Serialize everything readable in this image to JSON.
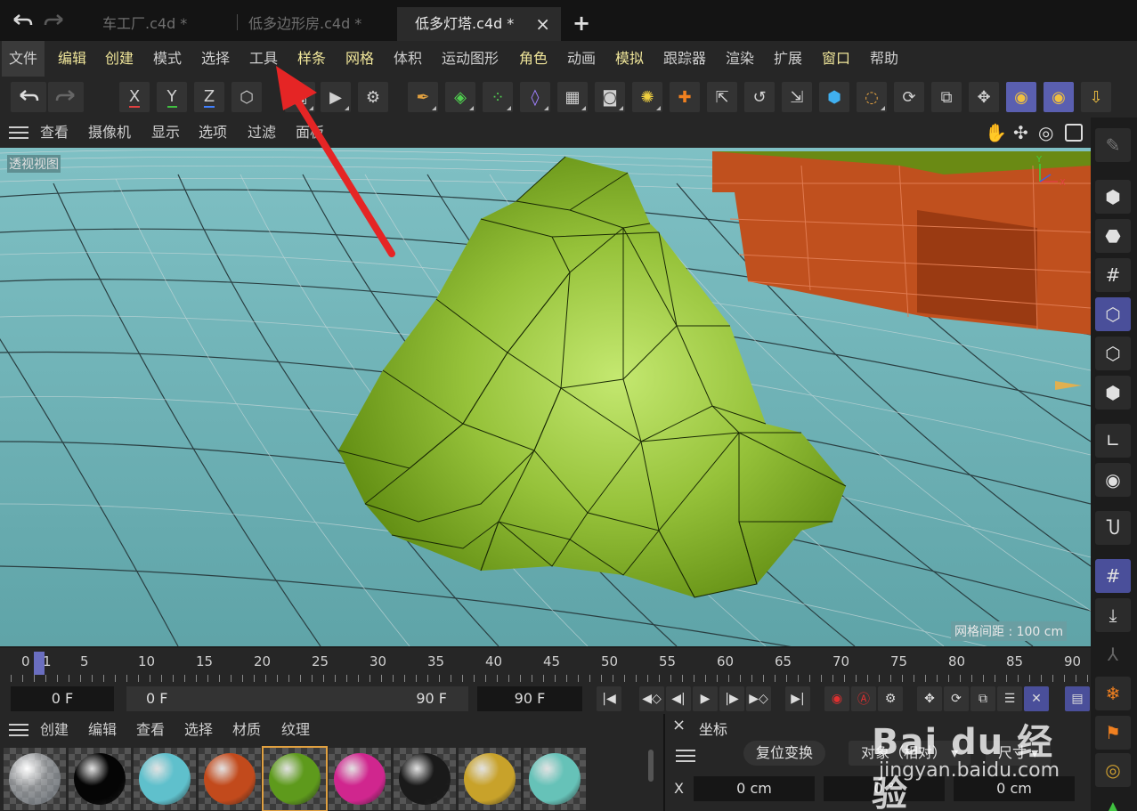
{
  "tabs": [
    {
      "label": "车工厂.c4d *"
    },
    {
      "label": "低多边形房.c4d *"
    },
    {
      "label": "低多灯塔.c4d *"
    }
  ],
  "tab_close": "×",
  "tab_add": "+",
  "menu": [
    {
      "label": "文件"
    },
    {
      "label": "编辑"
    },
    {
      "label": "创建"
    },
    {
      "label": "模式"
    },
    {
      "label": "选择"
    },
    {
      "label": "工具"
    },
    {
      "label": "样条"
    },
    {
      "label": "网格"
    },
    {
      "label": "体积"
    },
    {
      "label": "运动图形"
    },
    {
      "label": "角色"
    },
    {
      "label": "动画"
    },
    {
      "label": "模拟"
    },
    {
      "label": "跟踪器"
    },
    {
      "label": "渲染"
    },
    {
      "label": "扩展"
    },
    {
      "label": "窗口"
    },
    {
      "label": "帮助"
    }
  ],
  "toolbar": {
    "axis_x": "X",
    "axis_y": "Y",
    "axis_z": "Z"
  },
  "viewport_menu": [
    {
      "label": "查看"
    },
    {
      "label": "摄像机"
    },
    {
      "label": "显示"
    },
    {
      "label": "选项"
    },
    {
      "label": "过滤"
    },
    {
      "label": "面板"
    }
  ],
  "viewport": {
    "view_label": "透视视图",
    "grid_spacing": "网格间距 : 100 cm"
  },
  "timeline": {
    "ticks": [
      "0",
      "1",
      "5",
      "10",
      "15",
      "20",
      "25",
      "30",
      "35",
      "40",
      "45",
      "50",
      "55",
      "60",
      "65",
      "70",
      "75",
      "80",
      "85",
      "90"
    ]
  },
  "transport": {
    "current": "0 F",
    "start": "0 F",
    "end_range": "90 F",
    "end": "90 F"
  },
  "material_menu": [
    {
      "label": "创建"
    },
    {
      "label": "编辑"
    },
    {
      "label": "查看"
    },
    {
      "label": "选择"
    },
    {
      "label": "材质"
    },
    {
      "label": "纹理"
    }
  ],
  "materials": [
    {
      "color": "#d9dde0"
    },
    {
      "color": "#050505"
    },
    {
      "color": "#5fc0cc"
    },
    {
      "color": "#c24a1c"
    },
    {
      "color": "#5e9a1c"
    },
    {
      "color": "#d0268e"
    },
    {
      "color": "#1a1a1a"
    },
    {
      "color": "#c8a22a"
    },
    {
      "color": "#66c2b8"
    }
  ],
  "coord": {
    "title": "坐标",
    "close": "×",
    "reset_button": "复位变换",
    "mode": "对象（相对）",
    "size_label": "尺寸",
    "axis_label": "X",
    "x_value": "0 cm",
    "rot_value": "0 °",
    "size_value": "0 cm"
  },
  "watermark": {
    "brand": "Bai du 经验",
    "url": "jingyan.baidu.com"
  }
}
